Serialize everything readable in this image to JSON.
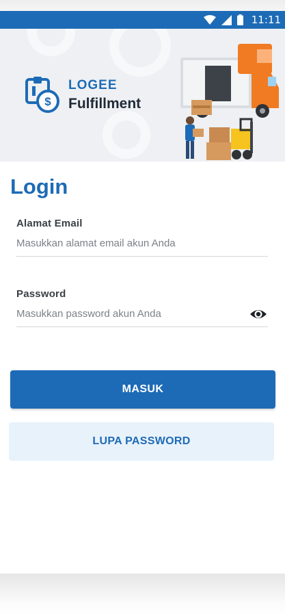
{
  "status_bar": {
    "time": "11:11",
    "icons": [
      "wifi-icon",
      "signal-icon",
      "battery-icon"
    ]
  },
  "brand": {
    "line1": "LOGEE",
    "line2": "Fulfillment",
    "icon": "logee-logo-icon"
  },
  "login": {
    "title": "Login",
    "email": {
      "label": "Alamat Email",
      "value": "",
      "placeholder": "Masukkan alamat email akun Anda"
    },
    "password": {
      "label": "Password",
      "value": "",
      "placeholder": "Masukkan password akun Anda",
      "toggle_icon": "eye-icon"
    },
    "submit_label": "MASUK",
    "forgot_label": "LUPA PASSWORD"
  },
  "colors": {
    "primary": "#1d6bb6",
    "secondary_bg": "#e8f2fb",
    "text_dark": "#3a3f45",
    "header_bg": "#eef0f3"
  }
}
